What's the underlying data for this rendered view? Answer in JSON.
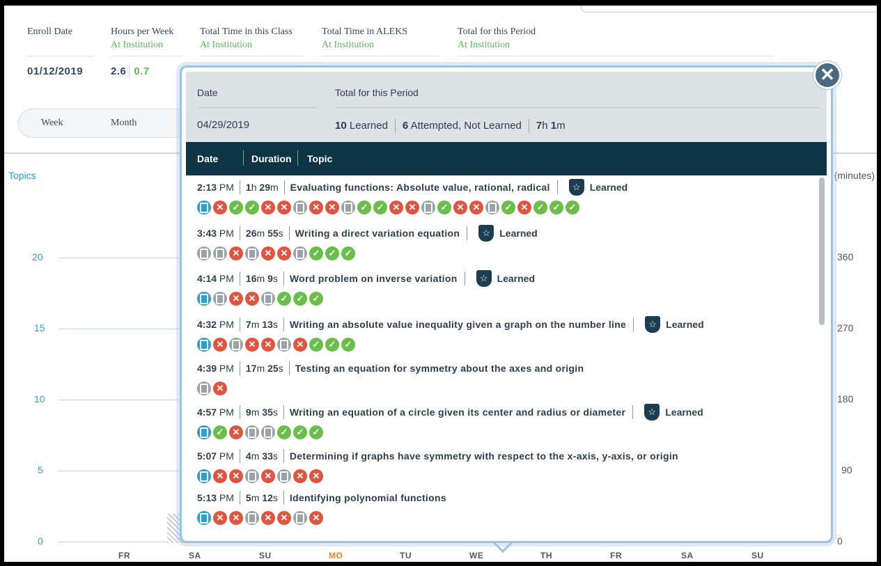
{
  "header": {
    "stats": [
      {
        "title": "Enroll Date",
        "sub": "",
        "value": "01/12/2019"
      },
      {
        "title": "Hours per Week",
        "sub": "At Institution",
        "value": "2.6",
        "value2": "0.7"
      },
      {
        "title": "Total Time in this Class",
        "sub": "At Institution"
      },
      {
        "title": "Total Time in ALEKS",
        "sub": "At Institution"
      },
      {
        "title": "Total for this Period",
        "sub": "At Institution"
      }
    ]
  },
  "toggle": {
    "week": "Week",
    "month": "Month"
  },
  "chart": {
    "left_axis_label": "Topics",
    "right_axis_label": "(minutes)",
    "left_ticks": [
      "20",
      "15",
      "10",
      "5",
      "0"
    ],
    "right_ticks": [
      "360",
      "270",
      "180",
      "90",
      "0"
    ],
    "days": [
      "FR",
      "SA",
      "SU",
      "MO",
      "TU",
      "WE",
      "TH",
      "FR",
      "SA",
      "SU"
    ],
    "active_day": "MO"
  },
  "modal": {
    "summary": {
      "date_label": "Date",
      "period_label": "Total for this Period",
      "date_value": "04/29/2019",
      "learned_count": "10",
      "learned_label": "Learned",
      "attempted_count": "6",
      "attempted_label": "Attempted, Not Learned",
      "time_h": "7",
      "time_m": "1"
    },
    "columns": {
      "date": "Date",
      "duration": "Duration",
      "topic": "Topic"
    },
    "entries": [
      {
        "time": "2:13",
        "ampm": "PM",
        "dur_a": "1",
        "dur_a_u": "h",
        "dur_b": "29",
        "dur_b_u": "m",
        "topic": "Evaluating functions: Absolute value, rational, radical",
        "learned": "Learned",
        "icons": [
          "exb",
          "x",
          "ok",
          "ok",
          "x",
          "x",
          "ex",
          "x",
          "x",
          "ex",
          "ok",
          "ok",
          "x",
          "x",
          "ex",
          "ok",
          "x",
          "x",
          "ex",
          "ok",
          "x",
          "ok",
          "ok",
          "ok"
        ]
      },
      {
        "time": "3:43",
        "ampm": "PM",
        "dur_a": "26",
        "dur_a_u": "m",
        "dur_b": "55",
        "dur_b_u": "s",
        "topic": "Writing a direct variation equation",
        "learned": "Learned",
        "icons": [
          "ex",
          "ex",
          "x",
          "ex",
          "x",
          "x",
          "ex",
          "ok",
          "ok",
          "ok"
        ]
      },
      {
        "time": "4:14",
        "ampm": "PM",
        "dur_a": "16",
        "dur_a_u": "m",
        "dur_b": "9",
        "dur_b_u": "s",
        "topic": "Word problem on inverse variation",
        "learned": "Learned",
        "icons": [
          "exb",
          "ex",
          "x",
          "x",
          "ex",
          "ok",
          "ok",
          "ok"
        ]
      },
      {
        "time": "4:32",
        "ampm": "PM",
        "dur_a": "7",
        "dur_a_u": "m",
        "dur_b": "13",
        "dur_b_u": "s",
        "topic": "Writing an absolute value inequality given a graph on the number line",
        "learned": "Learned",
        "icons": [
          "exb",
          "x",
          "ex",
          "x",
          "x",
          "ex",
          "x",
          "ok",
          "ok",
          "ok"
        ]
      },
      {
        "time": "4:39",
        "ampm": "PM",
        "dur_a": "17",
        "dur_a_u": "m",
        "dur_b": "25",
        "dur_b_u": "s",
        "topic": "Testing an equation for symmetry about the axes and origin",
        "learned": "",
        "icons": [
          "ex",
          "x"
        ]
      },
      {
        "time": "4:57",
        "ampm": "PM",
        "dur_a": "9",
        "dur_a_u": "m",
        "dur_b": "35",
        "dur_b_u": "s",
        "topic": "Writing an equation of a circle given its center and radius or diameter",
        "learned": "Learned",
        "icons": [
          "exb",
          "ok",
          "x",
          "ex",
          "ex",
          "ok",
          "ok",
          "ok"
        ]
      },
      {
        "time": "5:07",
        "ampm": "PM",
        "dur_a": "4",
        "dur_a_u": "m",
        "dur_b": "33",
        "dur_b_u": "s",
        "topic": "Determining if graphs have symmetry with respect to the x-axis, y-axis, or origin",
        "learned": "",
        "icons": [
          "exb",
          "x",
          "x",
          "ex",
          "x",
          "ex",
          "x",
          "x"
        ]
      },
      {
        "time": "5:13",
        "ampm": "PM",
        "dur_a": "5",
        "dur_a_u": "m",
        "dur_b": "12",
        "dur_b_u": "s",
        "topic": "Identifying polynomial functions",
        "learned": "",
        "icons": [
          "exb",
          "x",
          "x",
          "ex",
          "x",
          "x",
          "ex",
          "x"
        ]
      }
    ],
    "close_symbol": "✕"
  },
  "colors": {
    "accent": "#2a9fd8",
    "green": "#5cb85c",
    "red": "#e0553f",
    "dark": "#0e3545",
    "active_day": "#f07f1d"
  }
}
